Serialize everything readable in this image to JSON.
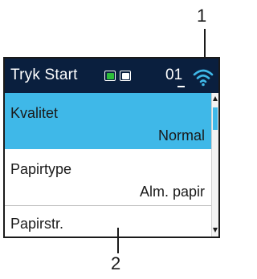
{
  "callouts": {
    "top": "1",
    "bottom": "2"
  },
  "status_bar": {
    "title": "Tryk Start",
    "count_prefix": "0",
    "count_digit": "1",
    "cartridge_colors": [
      "#2dbd3a",
      "#ffffff"
    ],
    "wifi_icon": "wifi-icon",
    "wifi_color": "#3fb8e8"
  },
  "menu": {
    "items": [
      {
        "label": "Kvalitet",
        "value": "Normal"
      },
      {
        "label": "Papirtype",
        "value": "Alm. papir"
      },
      {
        "label": "Papirstr.",
        "value": ""
      }
    ],
    "highlight_color": "#3fb8e8"
  }
}
